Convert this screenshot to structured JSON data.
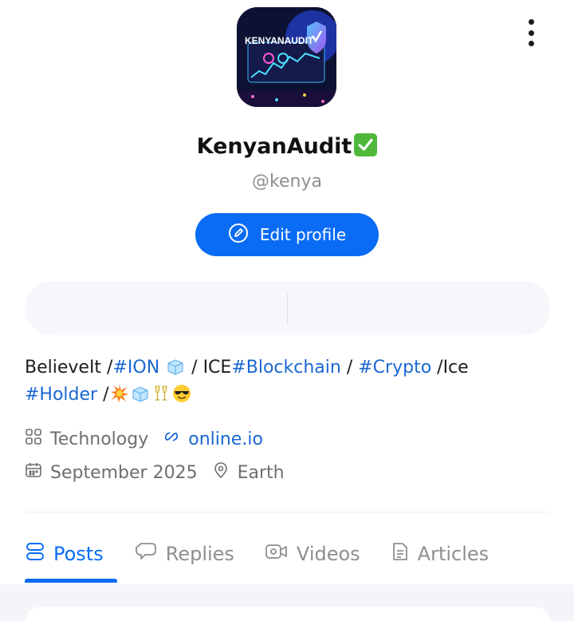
{
  "profile": {
    "display_name": "KenyanAudit",
    "handle": "@kenya",
    "avatar_logo_text": "KENYANAUDIT",
    "edit_button_label": "Edit profile",
    "bio": {
      "t1": "BelieveIt  /",
      "tag_ion": "#ION",
      "t2": " / ICE",
      "tag_blockchain": "#Blockchain",
      "t3": " / ",
      "tag_crypto": "#Crypto",
      "t4": " /Ice",
      "tag_holder": "#Holder",
      "t5": " /"
    },
    "category": "Technology",
    "website": "online.io",
    "joined": "September 2025",
    "location": "Earth"
  },
  "tabs": [
    {
      "label": "Posts",
      "icon": "posts-icon",
      "active": true
    },
    {
      "label": "Replies",
      "icon": "replies-icon",
      "active": false
    },
    {
      "label": "Videos",
      "icon": "video-icon",
      "active": false
    },
    {
      "label": "Articles",
      "icon": "article-icon",
      "active": false
    }
  ],
  "colors": {
    "accent": "#0a6cf5",
    "link": "#1a67d2",
    "muted": "#8e8e93",
    "verified": "#4fb83b"
  }
}
